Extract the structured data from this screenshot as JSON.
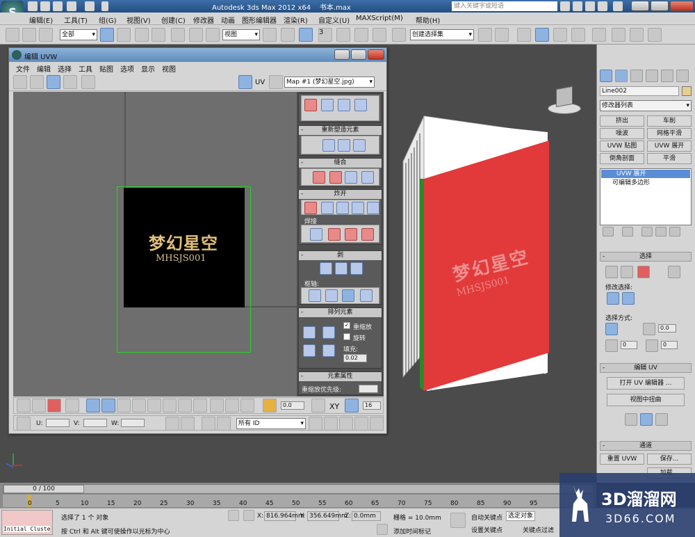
{
  "app": {
    "title": "Autodesk 3ds Max  2012 x64",
    "file": "书本.max",
    "search_placeholder": "键入关键字或短语",
    "logo_letter": "S"
  },
  "menubar": [
    "编辑(E)",
    "工具(T)",
    "组(G)",
    "视图(V)",
    "创建(C)",
    "修改器",
    "动画",
    "图形编辑器",
    "渲染(R)",
    "自定义(U)",
    "MAXScript(M)",
    "帮助(H)"
  ],
  "maintoolbar": {
    "filter_combo": "全部",
    "refcoord_combo": "视图",
    "selection_set": "创建选择集",
    "angle_snap_label": "3"
  },
  "uvw_window": {
    "title": "编辑 UVW",
    "menu": [
      "文件",
      "编辑",
      "选择",
      "工具",
      "贴图",
      "选项",
      "显示",
      "视图"
    ],
    "uv_label": "UV",
    "map_combo": "Map #1 (梦幻星空.jpg)",
    "texture_title": "梦幻星空",
    "texture_subtitle": "MHSJS001",
    "sections": {
      "reshape": "重新塑造元素",
      "stitch": "缝合",
      "explode": "炸开",
      "weld": "焊接",
      "peel": "剥",
      "pivot": "枢轴:",
      "arrange": "排列元素",
      "rescale": "重缩放",
      "rotate": "旋转",
      "padding_label": "填充:",
      "padding_value": "0.02",
      "element_props": "元素属性",
      "rescale_priority": "重缩放优先级:"
    },
    "bottom": {
      "spin1": "0.0",
      "xy": "XY",
      "spin2": "16",
      "u_label": "U:",
      "v_label": "V:",
      "w_label": "W:",
      "id_combo": "所有 ID"
    }
  },
  "viewport": {
    "book_cover_title": "梦幻星空",
    "book_cover_subtitle": "MHSJS001",
    "cover_color": "#e23a3a"
  },
  "cmdpanel": {
    "object_name": "Line002",
    "modifier_list": "修改器列表",
    "buttons": [
      "挤出",
      "车削",
      "噪波",
      "网格平滑",
      "UVW 贴图",
      "UVW 展开",
      "倒角剖面",
      "平滑"
    ],
    "stack": [
      "UVW 展开",
      "可编辑多边形"
    ],
    "select_section": "选择",
    "modify_select": "修改选择:",
    "select_by": "选择方式:",
    "spin_a": "0.0",
    "spin_b": "0",
    "spin_c": "0",
    "edit_uv_section": "编辑 UV",
    "open_uv_editor": "打开 UV 编辑器 ...",
    "view_pan": "视图中扭曲",
    "channel_section": "通道",
    "reset_uvw": "重置 UVW",
    "save": "保存...",
    "load": "加载..."
  },
  "timeline": {
    "slider": "0 / 100",
    "ticks": [
      "0",
      "5",
      "10",
      "15",
      "20",
      "25",
      "30",
      "35",
      "40",
      "45",
      "50",
      "55",
      "60",
      "65",
      "70",
      "75",
      "80",
      "85",
      "90",
      "95"
    ]
  },
  "status": {
    "maxscript": "Initial Cluste",
    "selected": "选择了 1 个 对象",
    "hint": "按 Ctrl 和 Alt 键可使操作以光标为中心",
    "x_label": "X:",
    "x_value": "816.964mm",
    "y_label": "Y:",
    "y_value": "356.649mm",
    "z_label": "Z:",
    "z_value": "0.0mm",
    "grid": "栅格 = 10.0mm",
    "add_time_tag": "添加时间标记",
    "auto_key": "自动关键点",
    "selected_combo": "选定对象",
    "set_key": "设置关键点",
    "key_filter": "关键点过滤",
    "watermark_text": "3D溜溜网",
    "watermark_url": "3D66.COM"
  }
}
